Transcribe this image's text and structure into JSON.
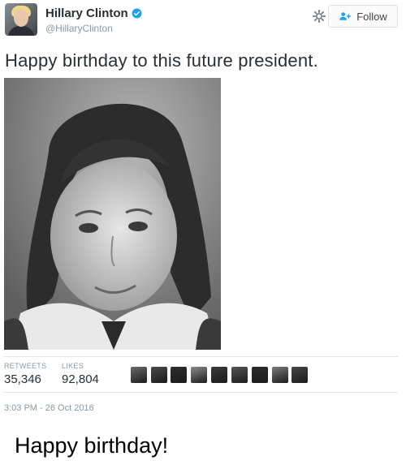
{
  "user": {
    "name": "Hillary Clinton",
    "handle": "@HillaryClinton",
    "verified": true
  },
  "actions": {
    "follow_label": "Follow"
  },
  "tweet": {
    "text": "Happy birthday to this future president.",
    "photo_icon": "childhood-portrait-photo"
  },
  "stats": {
    "retweets_label": "RETWEETS",
    "retweets_value": "35,346",
    "likes_label": "LIKES",
    "likes_value": "92,804"
  },
  "likers": [
    {
      "name": "liker-1",
      "color": "#6b6b6b"
    },
    {
      "name": "liker-2",
      "color": "#4a4a4a"
    },
    {
      "name": "liker-3",
      "color": "#2d2d2d"
    },
    {
      "name": "liker-4",
      "color": "#8a8a8a"
    },
    {
      "name": "liker-5",
      "color": "#3a3a3a"
    },
    {
      "name": "liker-6",
      "color": "#555555"
    },
    {
      "name": "liker-7",
      "color": "#2a2a2a"
    },
    {
      "name": "liker-8",
      "color": "#7a7a7a"
    },
    {
      "name": "liker-9",
      "color": "#454545"
    }
  ],
  "timestamp": "3:03 PM - 26 Oct 2016",
  "caption": "Happy birthday!",
  "colors": {
    "verified_blue": "#1da1f2",
    "muted_text": "#8899a6",
    "divider": "#e1e8ed"
  }
}
